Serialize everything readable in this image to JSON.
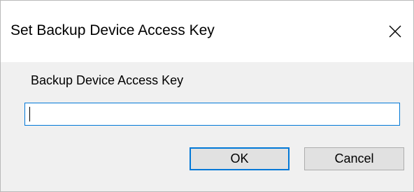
{
  "dialog": {
    "title": "Set Backup Device Access Key",
    "close_icon": "close-icon"
  },
  "form": {
    "label": "Backup Device Access Key",
    "value": "",
    "placeholder": ""
  },
  "buttons": {
    "ok_label": "OK",
    "cancel_label": "Cancel"
  },
  "colors": {
    "accent": "#0078d7",
    "dialog_background": "#f0f0f0",
    "titlebar_background": "#ffffff",
    "button_background": "#e1e1e1"
  }
}
